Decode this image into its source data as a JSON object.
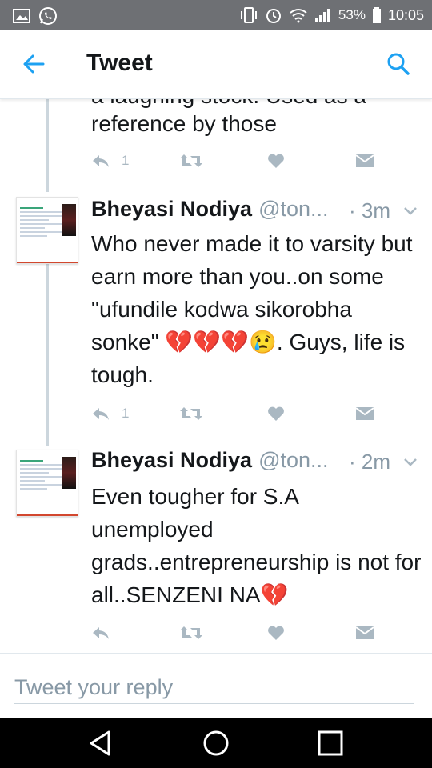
{
  "status_bar": {
    "battery": "53%",
    "time": "10:05"
  },
  "header": {
    "title": "Tweet"
  },
  "thread": {
    "partial_tweet": {
      "text_tail": "reference by those",
      "reply_count": "1"
    },
    "tweets": [
      {
        "name": "Bheyasi Nodiya",
        "handle": "@ton...",
        "time": "· 3m",
        "text": "Who never made it to varsity but earn more than you..on some \"ufundile kodwa sikorobha sonke\" 💔💔💔😢. Guys, life is tough.",
        "reply_count": "1"
      },
      {
        "name": "Bheyasi Nodiya",
        "handle": "@ton...",
        "time": "· 2m",
        "text": "Even tougher for S.A unemployed grads..entrepreneurship is not for all..SENZENI NA💔",
        "reply_count": ""
      }
    ]
  },
  "reply_box": {
    "placeholder": "Tweet your reply"
  },
  "colors": {
    "accent": "#1da1f2",
    "icon_grey": "#aab8c2",
    "status_bar": "#6e7074"
  }
}
